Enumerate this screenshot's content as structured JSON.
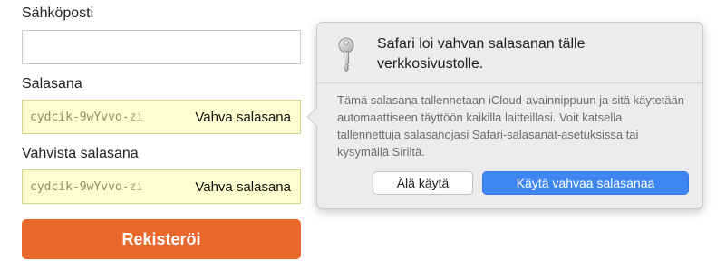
{
  "form": {
    "email_label": "Sähköposti",
    "email_value": "",
    "password_label": "Salasana",
    "password_value": "cydcik-9wYvvo-zi",
    "password_strength": "Vahva salasana",
    "confirm_label": "Vahvista salasana",
    "confirm_value": "cydcik-9wYvvo-zi",
    "confirm_strength": "Vahva salasana",
    "register_label": "Rekisteröi",
    "register_color": "#e8682b",
    "autofill_highlight_color": "#fdfdcf"
  },
  "popover": {
    "icon": "key-icon",
    "title": "Safari loi vahvan salasanan tälle verkkosivustolle.",
    "description": "Tämä salasana tallennetaan iCloud-avainnippuun ja sitä käytetään automaattiseen täyttöön kaikilla laitteillasi. Voit katsella tallennettuja salasanojasi Safari-salasanat-asetuksissa tai kysymällä Siriltä.",
    "dont_use_label": "Älä käytä",
    "use_strong_label": "Käytä vahvaa salasanaa",
    "accent_color": "#3f86f3"
  }
}
